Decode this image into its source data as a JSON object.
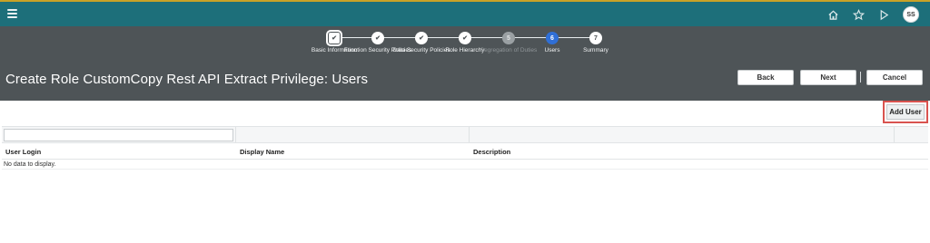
{
  "topbar": {
    "avatar_initials": "SS",
    "icons": [
      "menu-icon",
      "home-icon",
      "star-icon",
      "play-icon",
      "avatar"
    ]
  },
  "train": {
    "steps": [
      {
        "label": "Basic Information",
        "glyph": "✔",
        "state": "current-done"
      },
      {
        "label": "Function Security Policies",
        "glyph": "✔",
        "state": "done"
      },
      {
        "label": "Data Security Policies",
        "glyph": "✔",
        "state": "done"
      },
      {
        "label": "Role Hierarchy",
        "glyph": "✔",
        "state": "done"
      },
      {
        "label": "Segregation of Duties",
        "glyph": "5",
        "state": "disabled"
      },
      {
        "label": "Users",
        "glyph": "6",
        "state": "active"
      },
      {
        "label": "Summary",
        "glyph": "7",
        "state": "todo"
      }
    ]
  },
  "page": {
    "title": "Create Role CustomCopy Rest API Extract Privilege: Users"
  },
  "buttons": {
    "back": "Back",
    "next": "Next",
    "cancel": "Cancel",
    "add_user": "Add User"
  },
  "table": {
    "columns": [
      "User Login",
      "Display Name",
      "Description"
    ],
    "empty_message": "No data to display."
  },
  "colors": {
    "topbar": "#1d6f7a",
    "hero": "#4e5457",
    "active_step": "#2f6fd6",
    "highlight": "#d9534f"
  }
}
